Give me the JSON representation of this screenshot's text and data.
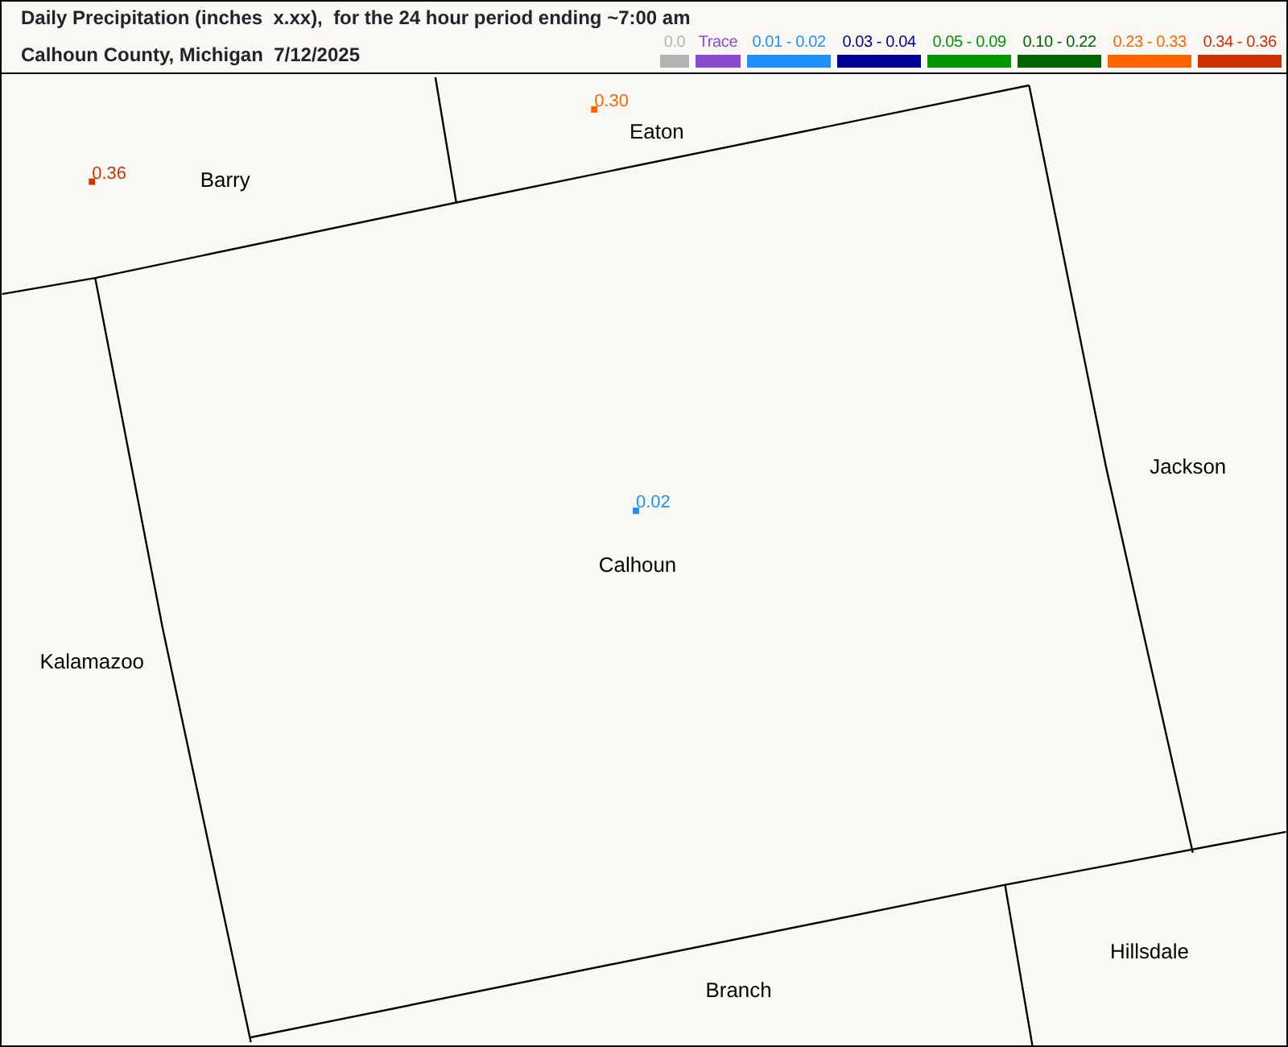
{
  "title": "Daily Precipitation (inches  x.xx),  for the 24 hour period ending ~7:00 am",
  "subtitle": "Calhoun County, Michigan  7/12/2025",
  "legend": [
    {
      "label": "0.0",
      "color": "#b4b4b4"
    },
    {
      "label": "Trace",
      "color": "#8a4bcf"
    },
    {
      "label": "0.01 - 0.02",
      "color": "#1e90ff"
    },
    {
      "label": "0.03 - 0.04",
      "color": "#000096"
    },
    {
      "label": "0.05 - 0.09",
      "color": "#009600"
    },
    {
      "label": "0.10 - 0.22",
      "color": "#006400"
    },
    {
      "label": "0.23 - 0.33",
      "color": "#ff6600"
    },
    {
      "label": "0.34 - 0.36",
      "color": "#cc3300"
    }
  ],
  "stations": [
    {
      "value": "0.30",
      "color": "#ff6600"
    },
    {
      "value": "0.36",
      "color": "#cc3300"
    },
    {
      "value": "0.02",
      "color": "#1e90ff"
    }
  ],
  "counties": [
    "Eaton",
    "Barry",
    "Jackson",
    "Calhoun",
    "Kalamazoo",
    "Hillsdale",
    "Branch"
  ]
}
